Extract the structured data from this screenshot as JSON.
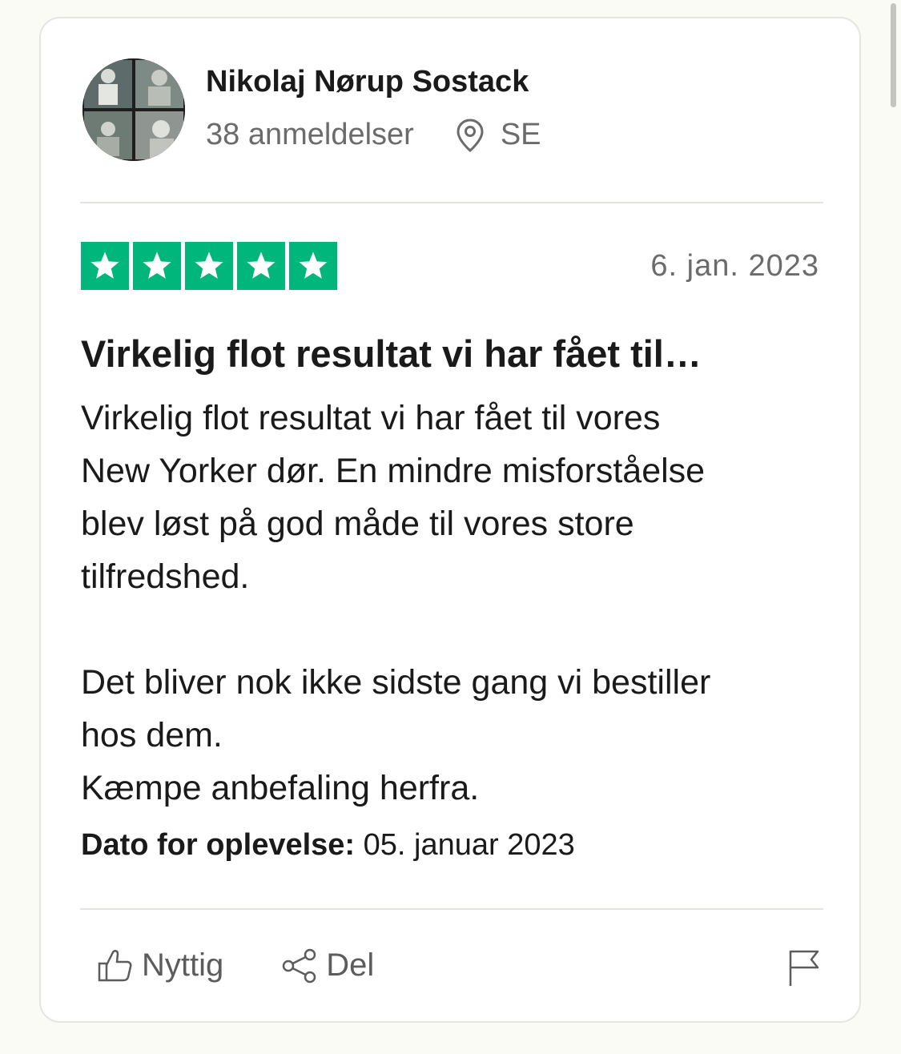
{
  "reviewer": {
    "name": "Nikolaj Nørup Sostack",
    "reviews_count": "38 anmeldelser",
    "country": "SE"
  },
  "review": {
    "rating": 5,
    "date": "6. jan. 2023",
    "title": "Virkelig flot resultat vi har fået til…",
    "body_lines": [
      "Virkelig flot resultat vi har fået til vores",
      "New Yorker dør. En mindre misforståelse",
      "blev løst på god måde til vores store",
      "tilfredshed.",
      "Det bliver nok ikke sidste gang vi bestiller",
      "hos dem.",
      "Kæmpe anbefaling herfra."
    ],
    "experience_label": "Dato for oplevelse:",
    "experience_date": "05. januar 2023"
  },
  "actions": {
    "useful_label": "Nyttig",
    "share_label": "Del"
  },
  "colors": {
    "star_green": "#00b67a",
    "page_background": "#fbfbf5",
    "muted_text": "#6b6b6b"
  },
  "icons": {
    "location": "map-pin-icon",
    "useful": "thumbs-up-icon",
    "share": "share-icon",
    "report": "flag-icon",
    "star": "star-icon"
  }
}
